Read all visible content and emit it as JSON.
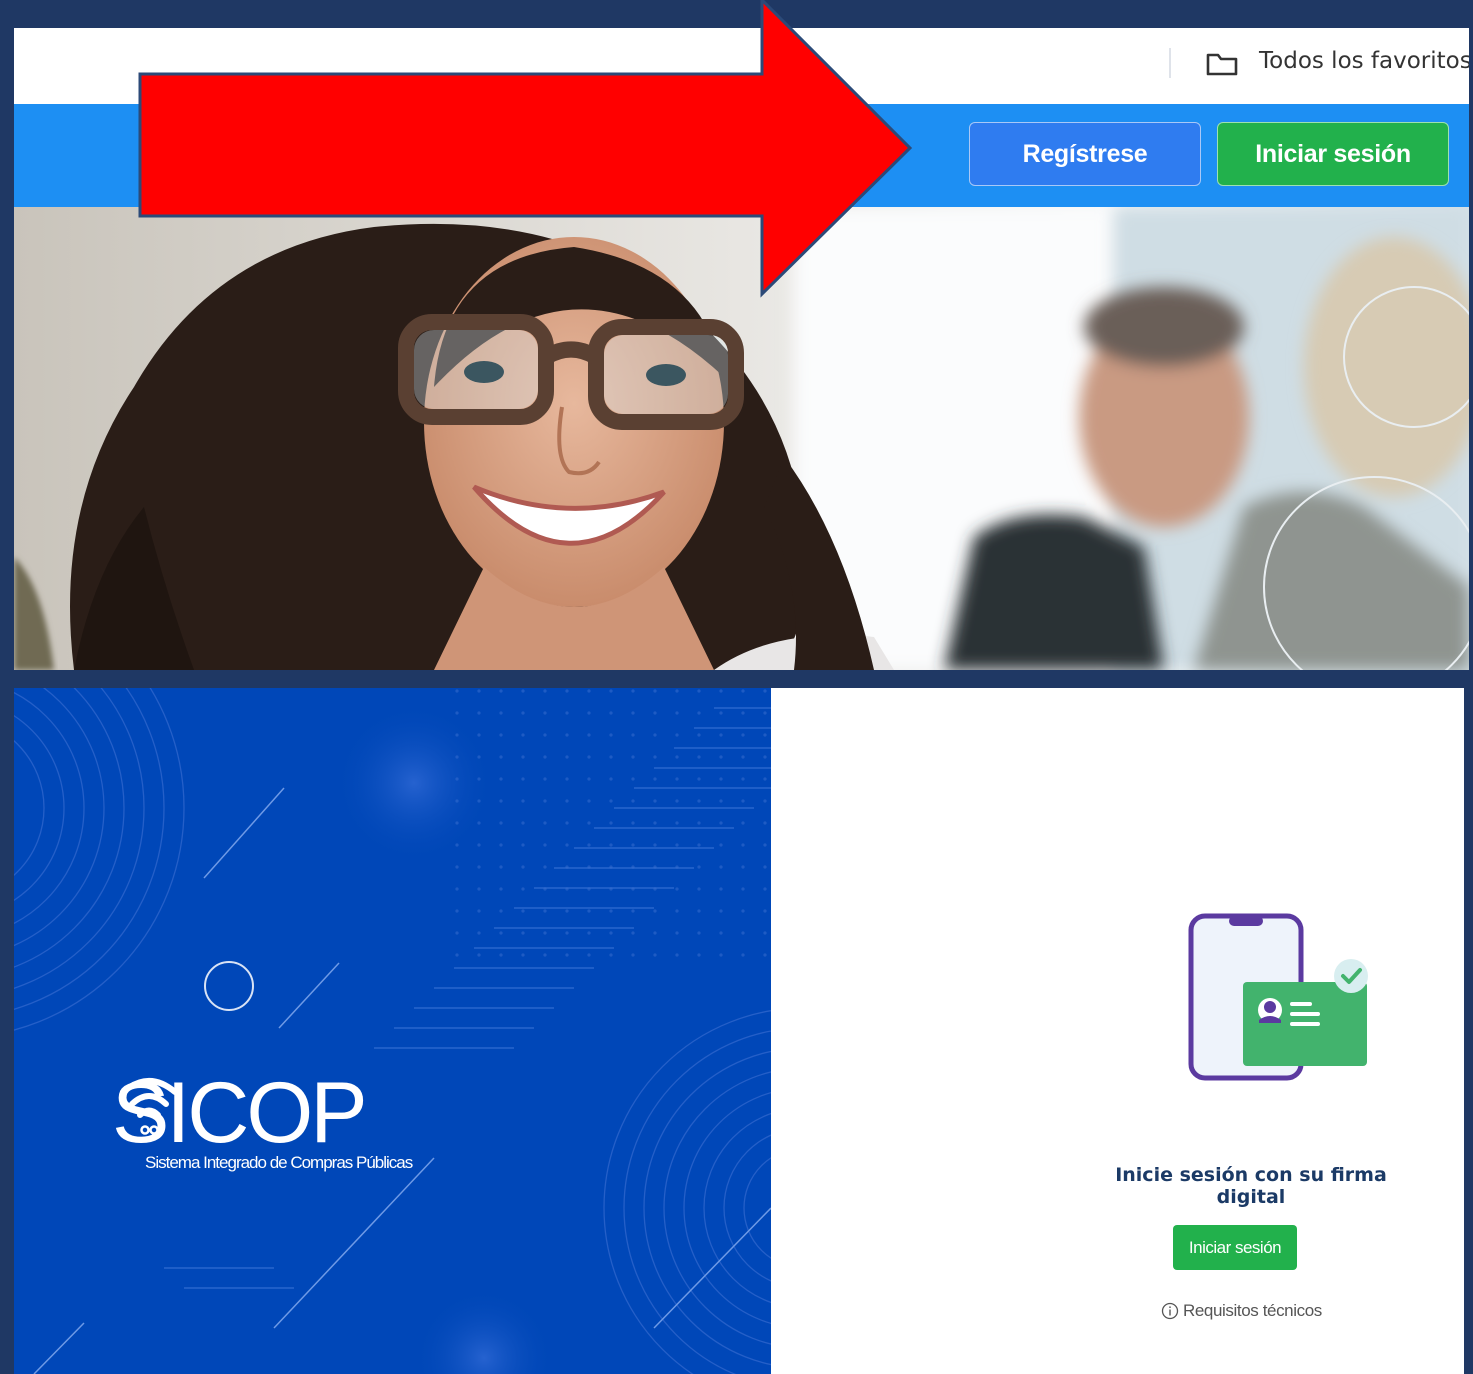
{
  "browser": {
    "bookmarks_label": "Todos los favoritos",
    "bookmarks_icon": "folder-icon"
  },
  "site_header": {
    "register_label": "Regístrese",
    "login_label": "Iniciar sesión",
    "colors": {
      "header": "#1d8ff3",
      "register": "#2f7cf0",
      "login": "#22b14c"
    }
  },
  "annotation": {
    "arrow_color": "#ff0000"
  },
  "sicop": {
    "name": "SICOP",
    "subtitle": "Sistema Integrado de Compras Públicas",
    "brand_color": "#0047b8"
  },
  "login_panel": {
    "heading": "Inicie sesión con su firma digital",
    "button_label": "Iniciar sesión",
    "requirements_label": "Requisitos técnicos",
    "illustration_icon": "digital-id-phone-icon"
  }
}
